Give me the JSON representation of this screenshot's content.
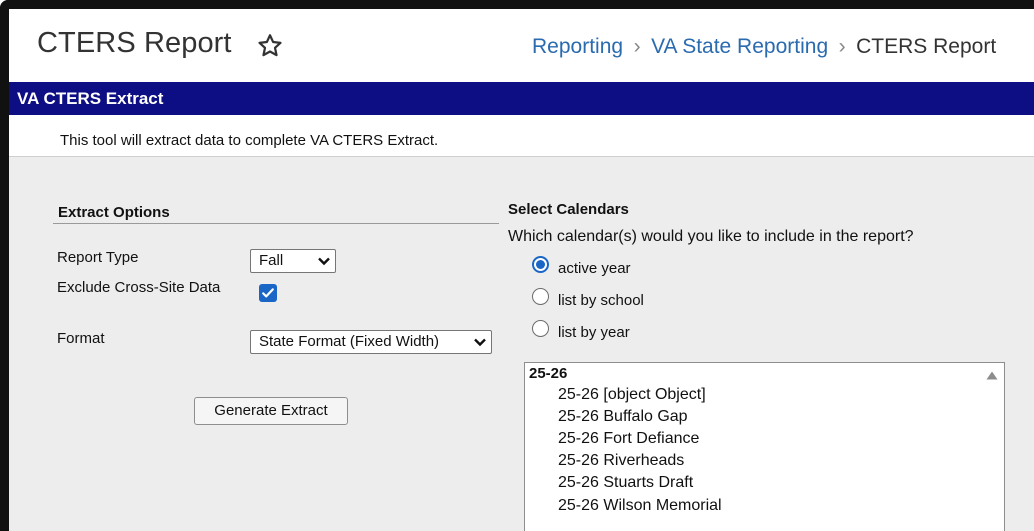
{
  "header": {
    "title": "CTERS Report",
    "breadcrumb": [
      "Reporting",
      "VA State Reporting",
      "CTERS Report"
    ]
  },
  "banner": {
    "title": "VA CTERS Extract"
  },
  "description": "This tool will extract data to complete VA CTERS Extract.",
  "extract_options": {
    "title": "Extract Options",
    "report_type_label": "Report Type",
    "report_type_value": "Fall",
    "exclude_label": "Exclude Cross-Site Data",
    "exclude_checked": true,
    "format_label": "Format",
    "format_value": "State Format (Fixed Width)",
    "generate_label": "Generate Extract"
  },
  "calendars": {
    "title": "Select Calendars",
    "question": "Which calendar(s) would you like to include in the report?",
    "radio_options": [
      "active year",
      "list by school",
      "list by year"
    ],
    "selected_radio": "active year",
    "list_group": "25-26",
    "list_items": [
      "25-26 [object Object]",
      "25-26 Buffalo Gap",
      "25-26 Fort Defiance",
      "25-26 Riverheads",
      "25-26 Stuarts Draft",
      "25-26 Wilson Memorial"
    ]
  },
  "colors": {
    "banner": "#0e0e84",
    "link": "#2a6bb0",
    "accent": "#1a66c7",
    "panel_bg": "#ededed"
  }
}
